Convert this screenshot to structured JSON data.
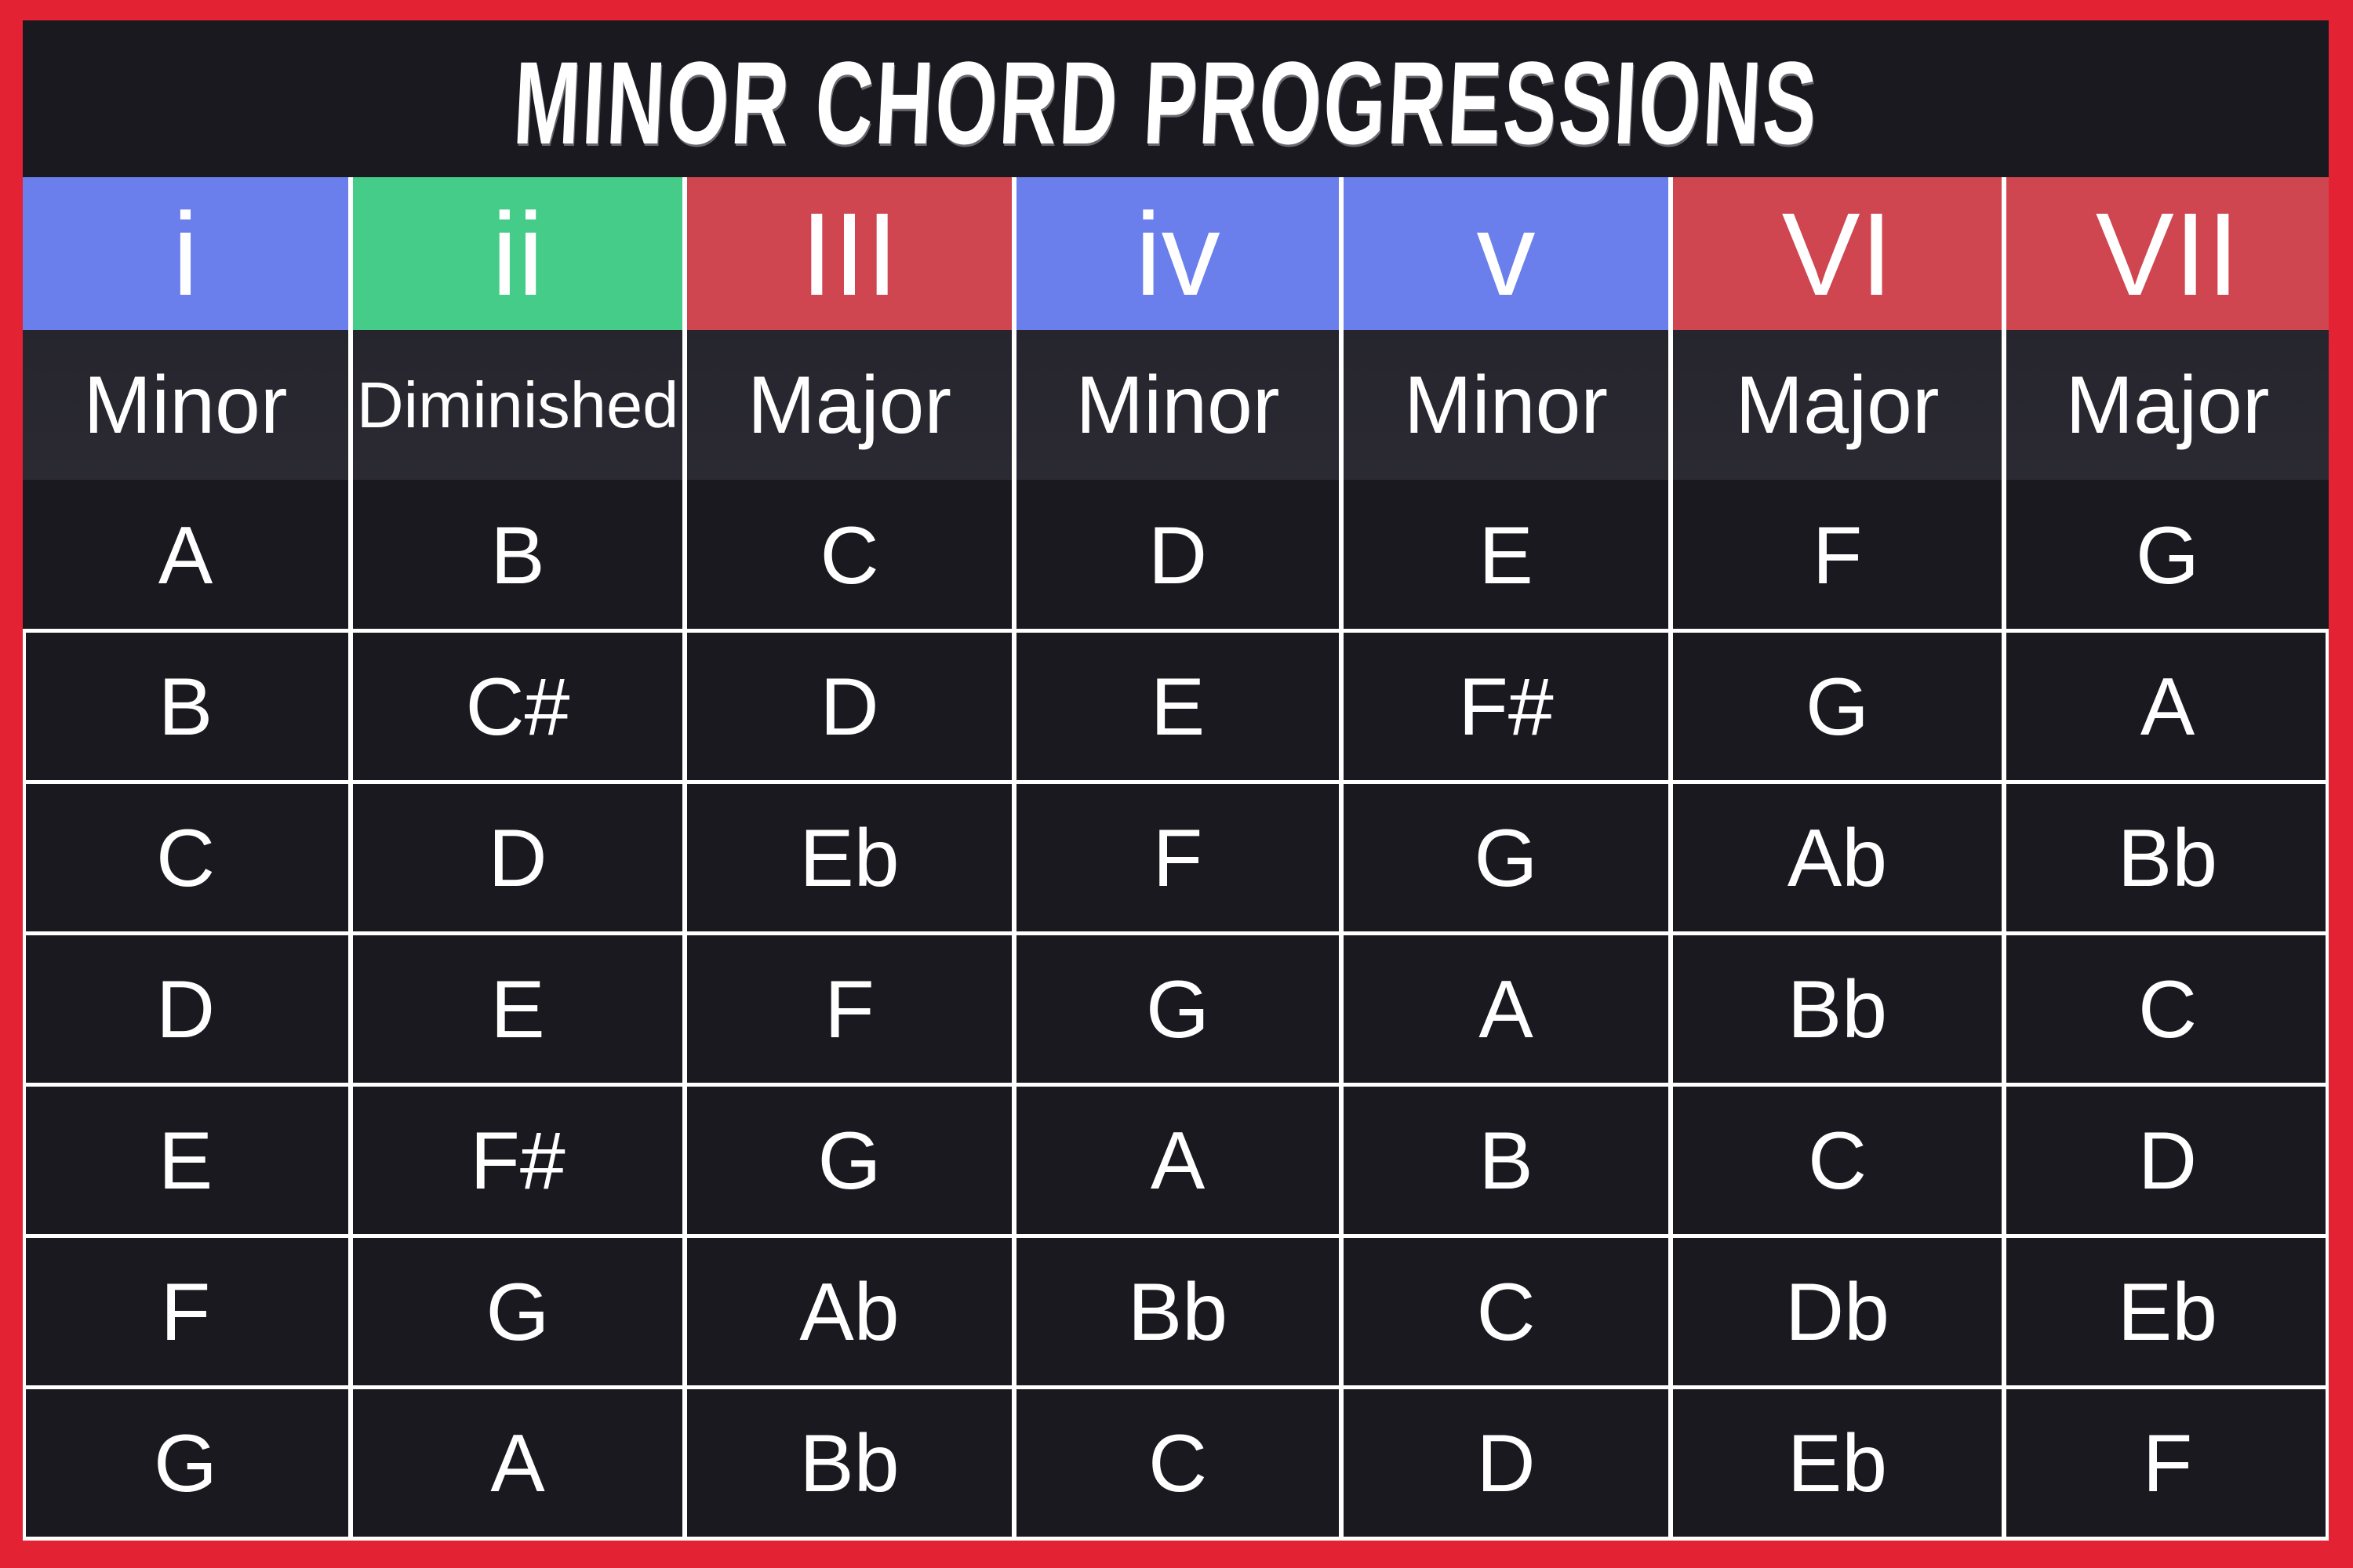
{
  "title": "MINOR CHORD PROGRESSIONS",
  "colors": {
    "frame": "#E32234",
    "background": "#1A1920",
    "type_row": "#28272F",
    "minor_blue": "#6A7FEC",
    "diminished_green": "#44CC88",
    "major_red": "#CF4550",
    "text": "#FFFFFF"
  },
  "columns": [
    {
      "numeral": "i",
      "quality": "Minor",
      "color_key": "minor_blue"
    },
    {
      "numeral": "ii",
      "quality": "Diminished",
      "color_key": "diminished_green"
    },
    {
      "numeral": "III",
      "quality": "Major",
      "color_key": "major_red"
    },
    {
      "numeral": "iv",
      "quality": "Minor",
      "color_key": "minor_blue"
    },
    {
      "numeral": "v",
      "quality": "Minor",
      "color_key": "minor_blue"
    },
    {
      "numeral": "VI",
      "quality": "Major",
      "color_key": "major_red"
    },
    {
      "numeral": "VII",
      "quality": "Major",
      "color_key": "major_red"
    }
  ],
  "rows": [
    [
      "A",
      "B",
      "C",
      "D",
      "E",
      "F",
      "G"
    ],
    [
      "B",
      "C#",
      "D",
      "E",
      "F#",
      "G",
      "A"
    ],
    [
      "C",
      "D",
      "Eb",
      "F",
      "G",
      "Ab",
      "Bb"
    ],
    [
      "D",
      "E",
      "F",
      "G",
      "A",
      "Bb",
      "C"
    ],
    [
      "E",
      "F#",
      "G",
      "A",
      "B",
      "C",
      "D"
    ],
    [
      "F",
      "G",
      "Ab",
      "Bb",
      "C",
      "Db",
      "Eb"
    ],
    [
      "G",
      "A",
      "Bb",
      "C",
      "D",
      "Eb",
      "F"
    ]
  ]
}
